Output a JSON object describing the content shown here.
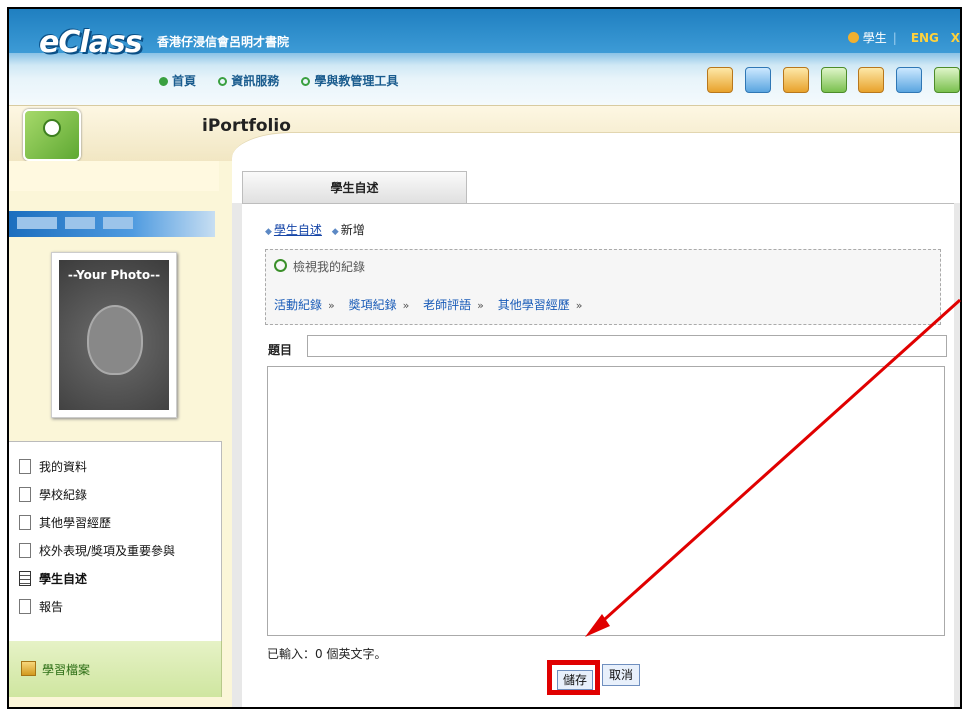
{
  "header": {
    "logo": "eClass",
    "school_name": "香港仔浸信會呂明才書院",
    "user_label": "學生",
    "lang_label": "ENG",
    "close_label": "X",
    "nav": [
      {
        "label": "首頁",
        "icon": "home-icon"
      },
      {
        "label": "資訊服務",
        "icon": "circle-icon"
      },
      {
        "label": "學與教管理工具",
        "icon": "circle-icon"
      }
    ],
    "tool_icons": [
      "tool-icon-1",
      "tool-icon-2",
      "tool-icon-3",
      "tool-icon-4",
      "tool-icon-5",
      "tool-icon-6",
      "tool-icon-7"
    ]
  },
  "module": {
    "title": "iPortfolio"
  },
  "sidebar": {
    "photo_caption": "--Your Photo--",
    "menu": [
      {
        "label": "我的資料",
        "active": false
      },
      {
        "label": "學校紀錄",
        "active": false
      },
      {
        "label": "其他學習經歷",
        "active": false
      },
      {
        "label": "校外表現/獎項及重要參與",
        "active": false
      },
      {
        "label": "學生自述",
        "active": true
      },
      {
        "label": "報告",
        "active": false
      }
    ],
    "learning_folder": "學習檔案"
  },
  "main": {
    "tab": "學生自述",
    "breadcrumb": {
      "link": "學生自述",
      "current": "新增"
    },
    "view_records": "檢視我的紀錄",
    "record_links": [
      "活動紀錄",
      "獎項紀錄",
      "老師評語",
      "其他學習經歷"
    ],
    "title_label": "題目",
    "title_value": "",
    "body_value": "",
    "char_count": "已輸入：0 個英文字。",
    "save_label": "儲存",
    "cancel_label": "取消"
  },
  "colors": {
    "header_blue": "#2f8ac8",
    "highlight_red": "#e00000",
    "link_blue": "#1646a8"
  }
}
